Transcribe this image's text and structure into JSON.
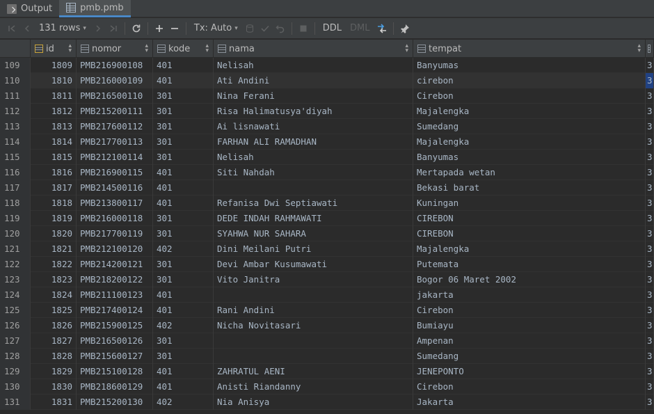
{
  "tabs": [
    {
      "label": "Output",
      "icon": "output-icon"
    },
    {
      "label": "pmb.pmb",
      "icon": "table-icon"
    }
  ],
  "toolbar": {
    "rows_label": "131 rows",
    "tx_label": "Tx: Auto",
    "ddl_label": "DDL",
    "dml_label": "DML"
  },
  "columns": [
    {
      "label": "id",
      "key": true
    },
    {
      "label": "nomor",
      "key": false
    },
    {
      "label": "kode",
      "key": false
    },
    {
      "label": "nama",
      "key": false
    },
    {
      "label": "tempat",
      "key": false
    }
  ],
  "rows": [
    {
      "n": "109",
      "id": "1809",
      "nomor": "PMB216900108",
      "kode": "401",
      "nama": "Nelisah",
      "tempat": "Banyumas",
      "next": "3"
    },
    {
      "n": "110",
      "id": "1810",
      "nomor": "PMB216000109",
      "kode": "401",
      "nama": "Ati Andini",
      "tempat": "cirebon",
      "next": "3"
    },
    {
      "n": "111",
      "id": "1811",
      "nomor": "PMB216500110",
      "kode": "301",
      "nama": "Nina Ferani",
      "tempat": "Cirebon",
      "next": "3"
    },
    {
      "n": "112",
      "id": "1812",
      "nomor": "PMB215200111",
      "kode": "301",
      "nama": "Risa Halimatusya'diyah",
      "tempat": "Majalengka",
      "next": "3"
    },
    {
      "n": "113",
      "id": "1813",
      "nomor": "PMB217600112",
      "kode": "301",
      "nama": "Ai lisnawati",
      "tempat": "Sumedang",
      "next": "3"
    },
    {
      "n": "114",
      "id": "1814",
      "nomor": "PMB217700113",
      "kode": "301",
      "nama": "FARHAN ALI RAMADHAN",
      "tempat": "Majalengka",
      "next": "3"
    },
    {
      "n": "115",
      "id": "1815",
      "nomor": "PMB212100114",
      "kode": "301",
      "nama": "Nelisah",
      "tempat": "Banyumas",
      "next": "3"
    },
    {
      "n": "116",
      "id": "1816",
      "nomor": "PMB216900115",
      "kode": "401",
      "nama": "Siti Nahdah",
      "tempat": "Mertapada wetan",
      "next": "3"
    },
    {
      "n": "117",
      "id": "1817",
      "nomor": "PMB214500116",
      "kode": "401",
      "nama": "",
      "tempat": "Bekasi barat",
      "next": "3"
    },
    {
      "n": "118",
      "id": "1818",
      "nomor": "PMB213800117",
      "kode": "401",
      "nama": "Refanisa Dwi Septiawati",
      "tempat": "Kuningan",
      "next": "3"
    },
    {
      "n": "119",
      "id": "1819",
      "nomor": "PMB216000118",
      "kode": "301",
      "nama": "DEDE INDAH RAHMAWATI",
      "tempat": "CIREBON",
      "next": "3"
    },
    {
      "n": "120",
      "id": "1820",
      "nomor": "PMB217700119",
      "kode": "301",
      "nama": "SYAHWA NUR SAHARA",
      "tempat": "CIREBON",
      "next": "3"
    },
    {
      "n": "121",
      "id": "1821",
      "nomor": "PMB212100120",
      "kode": "402",
      "nama": "Dini Meilani Putri",
      "tempat": "Majalengka",
      "next": "3"
    },
    {
      "n": "122",
      "id": "1822",
      "nomor": "PMB214200121",
      "kode": "301",
      "nama": "Devi Ambar Kusumawati",
      "tempat": "Putemata",
      "next": "3"
    },
    {
      "n": "123",
      "id": "1823",
      "nomor": "PMB218200122",
      "kode": "301",
      "nama": "Vito Janitra",
      "tempat": "Bogor 06 Maret 2002",
      "next": "3"
    },
    {
      "n": "124",
      "id": "1824",
      "nomor": "PMB211100123",
      "kode": "401",
      "nama": "",
      "tempat": "jakarta",
      "next": "3"
    },
    {
      "n": "125",
      "id": "1825",
      "nomor": "PMB217400124",
      "kode": "401",
      "nama": "Rani Andini",
      "tempat": "Cirebon",
      "next": "3"
    },
    {
      "n": "126",
      "id": "1826",
      "nomor": "PMB215900125",
      "kode": "402",
      "nama": "Nicha Novitasari",
      "tempat": "Bumiayu",
      "next": "3"
    },
    {
      "n": "127",
      "id": "1827",
      "nomor": "PMB216500126",
      "kode": "301",
      "nama": "",
      "tempat": "Ampenan",
      "next": "3"
    },
    {
      "n": "128",
      "id": "1828",
      "nomor": "PMB215600127",
      "kode": "301",
      "nama": "",
      "tempat": "Sumedang",
      "next": "3"
    },
    {
      "n": "129",
      "id": "1829",
      "nomor": "PMB215100128",
      "kode": "401",
      "nama": "ZAHRATUL AENI",
      "tempat": "JENEPONTO",
      "next": "3"
    },
    {
      "n": "130",
      "id": "1830",
      "nomor": "PMB218600129",
      "kode": "401",
      "nama": "Anisti Riandanny",
      "tempat": "Cirebon",
      "next": "3"
    },
    {
      "n": "131",
      "id": "1831",
      "nomor": "PMB215200130",
      "kode": "402",
      "nama": "Nia Anisya",
      "tempat": "Jakarta",
      "next": "3"
    }
  ]
}
